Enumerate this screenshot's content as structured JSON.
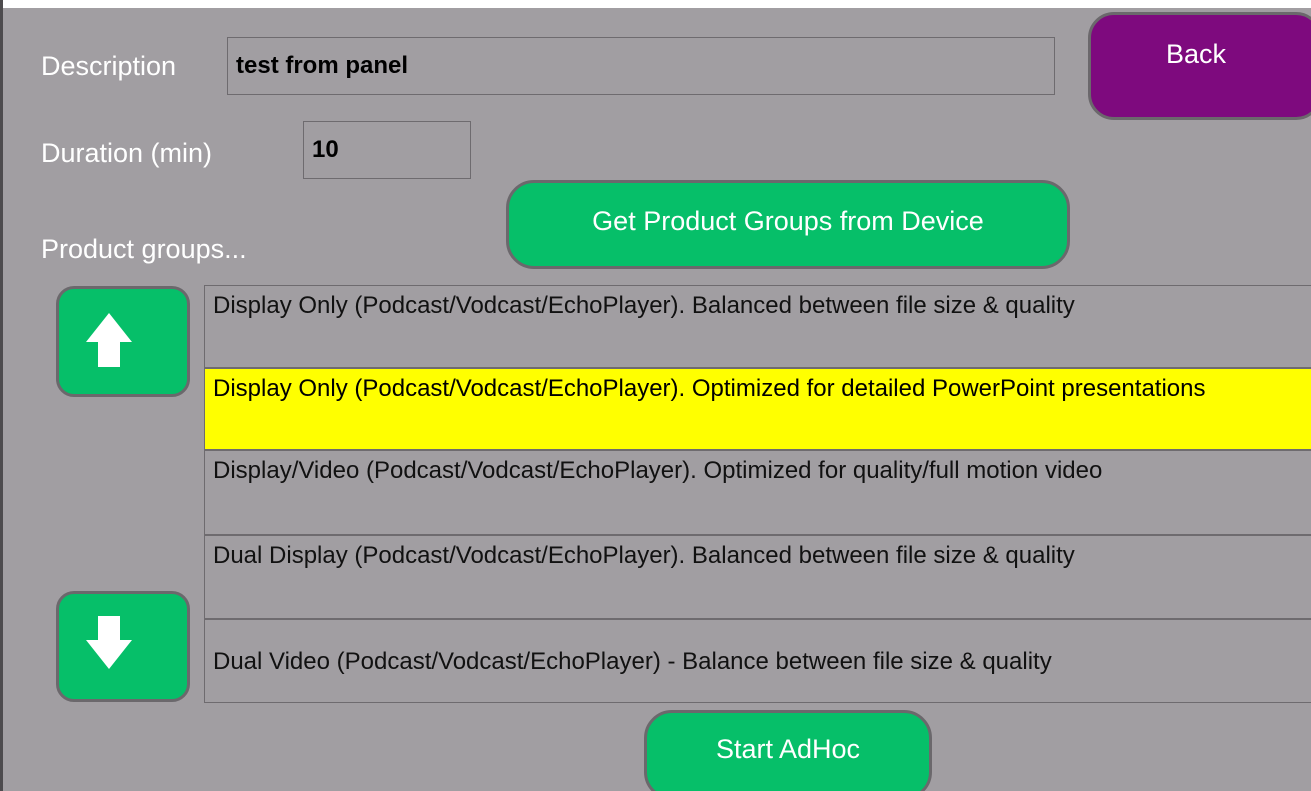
{
  "form": {
    "description_label": "Description",
    "description_value": "test from panel",
    "duration_label": "Duration (min)",
    "duration_value": "10",
    "product_groups_label": "Product groups..."
  },
  "buttons": {
    "back_label": "Back",
    "get_product_groups_label": "Get Product Groups from Device",
    "start_adhoc_label": "Start AdHoc"
  },
  "product_groups": {
    "items": [
      {
        "label": "Display Only (Podcast/Vodcast/EchoPlayer). Balanced between file size & quality",
        "selected": false
      },
      {
        "label": "Display Only (Podcast/Vodcast/EchoPlayer). Optimized for detailed PowerPoint presentations",
        "selected": true
      },
      {
        "label": "Display/Video (Podcast/Vodcast/EchoPlayer). Optimized for quality/full motion video",
        "selected": false
      },
      {
        "label": "Dual Display (Podcast/Vodcast/EchoPlayer). Balanced between file size & quality",
        "selected": false
      },
      {
        "label": "Dual Video (Podcast/Vodcast/EchoPlayer) - Balance between file size & quality",
        "selected": false
      }
    ]
  },
  "icons": {
    "scroll_up": "arrow-up-icon",
    "scroll_down": "arrow-down-icon"
  },
  "colors": {
    "panel_background": "#a19ea2",
    "green_button": "#06bf69",
    "purple_button": "#7e0a7e",
    "selected_row": "#ffff00"
  }
}
